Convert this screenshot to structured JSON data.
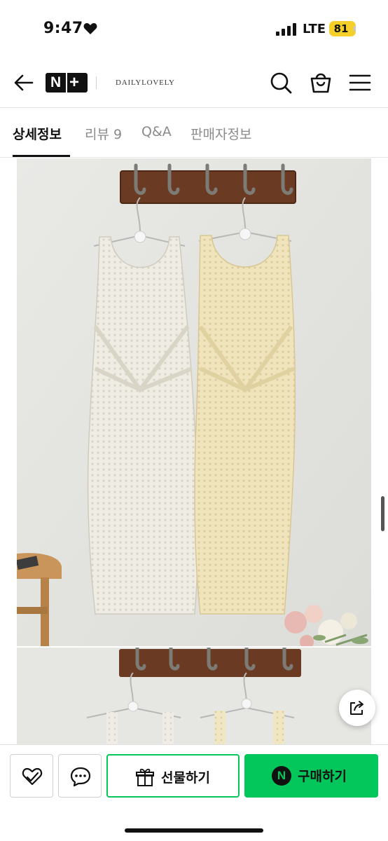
{
  "status_bar": {
    "time": "9:47",
    "network": "LTE",
    "battery": "81"
  },
  "header": {
    "logo_n": "N",
    "logo_plus": "+",
    "store_name": "DAILYLOVELY"
  },
  "tabs": [
    {
      "label": "상세정보",
      "active": true
    },
    {
      "label": "리뷰 9",
      "active": false
    },
    {
      "label": "Q&A",
      "active": false
    },
    {
      "label": "판매자정보",
      "active": false
    }
  ],
  "bottom_bar": {
    "gift_label": "선물하기",
    "buy_label": "구매하기",
    "npay_letter": "N"
  },
  "colors": {
    "accent_green": "#03c75a",
    "battery_yellow": "#f5d02a"
  }
}
